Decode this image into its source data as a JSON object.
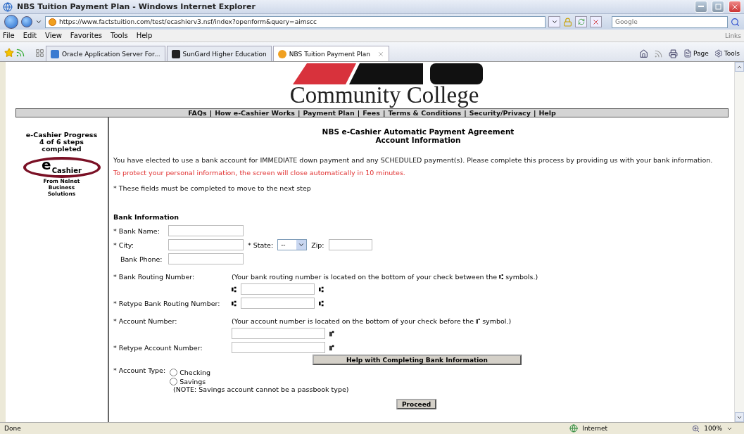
{
  "window": {
    "title": "NBS Tuition Payment Plan - Windows Internet Explorer"
  },
  "address_bar": {
    "url": "https://www.factstuition.com/test/ecashierv3.nsf/index?openform&query=aimscc",
    "search_placeholder": "Google"
  },
  "menu": [
    "File",
    "Edit",
    "View",
    "Favorites",
    "Tools",
    "Help"
  ],
  "links_label": "Links",
  "tabs": [
    {
      "label": "Oracle Application Server For...",
      "selected": false,
      "kind": "oracle"
    },
    {
      "label": "SunGard Higher Education",
      "selected": false,
      "kind": "sungard"
    },
    {
      "label": "NBS Tuition Payment Plan",
      "selected": true,
      "kind": "nbs"
    }
  ],
  "command_bar": [
    "Page",
    "Tools"
  ],
  "page": {
    "college_name": "Community College",
    "nav": [
      {
        "kind": "link",
        "label": "FAQs"
      },
      {
        "kind": "sep",
        "label": "|"
      },
      {
        "kind": "link",
        "label": "How e-Cashier Works"
      },
      {
        "kind": "sep",
        "label": "|"
      },
      {
        "kind": "link",
        "label": "Payment Plan"
      },
      {
        "kind": "sep",
        "label": "|"
      },
      {
        "kind": "link",
        "label": "Fees"
      },
      {
        "kind": "sep",
        "label": "|"
      },
      {
        "kind": "link",
        "label": "Terms & Conditions"
      },
      {
        "kind": "sep",
        "label": "|"
      },
      {
        "kind": "link",
        "label": "Security/Privacy"
      },
      {
        "kind": "sep",
        "label": "|"
      },
      {
        "kind": "link",
        "label": "Help"
      }
    ],
    "progress": [
      "e-Cashier Progress",
      "4 of 6 steps",
      "completed"
    ],
    "ecashier_logo": {
      "letter": "e",
      "word": "Cashier",
      "tagline": [
        "From Nelnet",
        "Business",
        "Solutions"
      ]
    },
    "heading": [
      "NBS e-Cashier Automatic Payment Agreement",
      "Account Information"
    ],
    "intro": "You have elected to use a bank account for IMMEDIATE down payment and any SCHEDULED payment(s). Please complete this process by providing us with your bank information.",
    "warning": "To protect your personal information, the screen will close automatically in 10 minutes.",
    "required_note": "* These fields must be completed to move to the next step",
    "section_title": "Bank Information",
    "bank_name": {
      "label": "* Bank Name:"
    },
    "city": {
      "label": "* City:"
    },
    "state": {
      "label": "* State:",
      "value": "--"
    },
    "zip": {
      "label": "Zip:"
    },
    "bank_phone": {
      "label": "Bank Phone:"
    },
    "routing": {
      "label": "* Bank Routing Number:",
      "note": "(Your bank routing number is located on the bottom of your check between the ⑆ symbols.)",
      "symbol_before": "⑆",
      "symbol_after": "⑆"
    },
    "routing_retype": {
      "label": "* Retype Bank Routing Number:",
      "symbol_before": "⑆",
      "symbol_after": "⑆"
    },
    "account": {
      "label": "* Account Number:",
      "note": "(Your account number is located on the bottom of your check before the ⑈ symbol.)",
      "symbol_after": "⑈"
    },
    "account_retype": {
      "label": "* Retype Account Number:",
      "symbol_after": "⑈"
    },
    "help_button": "Help with Completing Bank Information",
    "account_type": {
      "label": "* Account Type:",
      "options": [
        {
          "label": "Checking",
          "selected": false
        },
        {
          "label": "Savings",
          "selected": false
        }
      ],
      "note": "(NOTE: Savings account cannot be a passbook type)"
    },
    "proceed_button": "Proceed"
  },
  "status_bar": {
    "text": "Done",
    "zone": "Internet",
    "zoom": "100%"
  }
}
